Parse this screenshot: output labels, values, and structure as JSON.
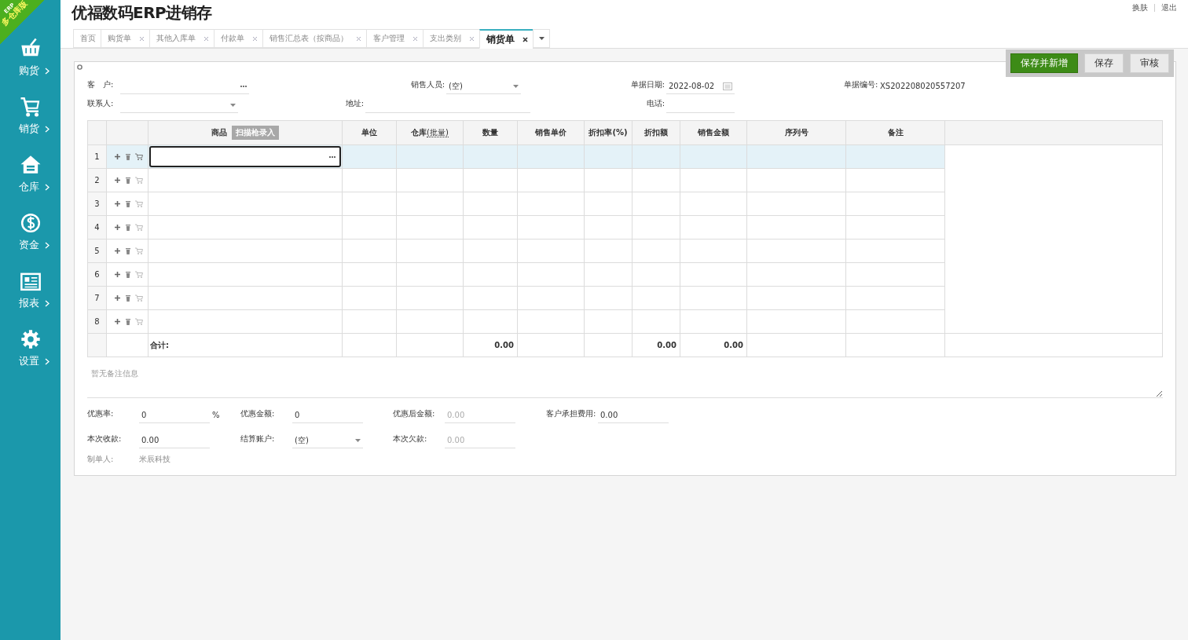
{
  "corner_ribbon": {
    "edition": "ERP",
    "name": "多仓库版"
  },
  "app_title": "优福数码ERP进销存",
  "header_links": [
    "换肤",
    "退出"
  ],
  "sidebar": {
    "items": [
      {
        "label": "购货"
      },
      {
        "label": "销货"
      },
      {
        "label": "仓库"
      },
      {
        "label": "资金"
      },
      {
        "label": "报表"
      },
      {
        "label": "设置"
      }
    ]
  },
  "tabs": [
    {
      "label": "首页",
      "closable": false,
      "selected": false
    },
    {
      "label": "购货单",
      "closable": true,
      "selected": false
    },
    {
      "label": "其他入库单",
      "closable": true,
      "selected": false
    },
    {
      "label": "付款单",
      "closable": true,
      "selected": false
    },
    {
      "label": "销售汇总表（按商品）",
      "closable": true,
      "selected": false
    },
    {
      "label": "客户管理",
      "closable": true,
      "selected": false
    },
    {
      "label": "支出类别",
      "closable": true,
      "selected": false
    },
    {
      "label": "销货单",
      "closable": true,
      "selected": true
    }
  ],
  "toolbar": {
    "buttons": [
      {
        "label": "保存并新增",
        "kind": "primary"
      },
      {
        "label": "保存",
        "kind": "default"
      },
      {
        "label": "审核",
        "kind": "default"
      }
    ]
  },
  "bill_header": {
    "rows": [
      [
        {
          "label": "客　户:",
          "kind": "lookup"
        },
        {
          "label": "销售人员:",
          "kind": "select",
          "value": "(空)"
        },
        {
          "label": "单据日期:",
          "kind": "date",
          "value": "2022-08-02"
        },
        {
          "label": "单据编号:",
          "kind": "static",
          "value": "XS202208020557207"
        }
      ],
      [
        {
          "label": "联系人:",
          "kind": "select"
        },
        {
          "label": "地址:",
          "kind": "text"
        },
        {
          "label": "电话:",
          "kind": "text"
        }
      ]
    ]
  },
  "table": {
    "columns": [
      {
        "label": "商品",
        "button": "扫描枪录入"
      },
      {
        "label": "单位"
      },
      {
        "label": "仓库",
        "link": "(批量)"
      },
      {
        "label": "数量"
      },
      {
        "label": "销售单价"
      },
      {
        "label": "折扣率(%)"
      },
      {
        "label": "折扣额"
      },
      {
        "label": "销售金额"
      },
      {
        "label": "序列号"
      },
      {
        "label": "备注"
      }
    ],
    "rows": [
      {
        "number": "1",
        "selected": true,
        "editing": true
      },
      {
        "number": "2",
        "selected": false,
        "editing": false
      },
      {
        "number": "3",
        "selected": false,
        "editing": false
      },
      {
        "number": "4",
        "selected": false,
        "editing": false
      },
      {
        "number": "5",
        "selected": false,
        "editing": false
      },
      {
        "number": "6",
        "selected": false,
        "editing": false
      },
      {
        "number": "7",
        "selected": false,
        "editing": false
      },
      {
        "number": "8",
        "selected": false,
        "editing": false
      }
    ],
    "totals": {
      "label": "合计:",
      "quantity": "0.00",
      "discount_amount": "0.00",
      "amount": "0.00"
    }
  },
  "remarks": {
    "placeholder": "暂无备注信息"
  },
  "footer": {
    "rows": [
      [
        {
          "label": "优惠率:",
          "kind": "input",
          "value": "0",
          "suffix": "%",
          "disabled": false
        },
        {
          "label": "优惠金额:",
          "kind": "input",
          "value": "0",
          "disabled": false
        },
        {
          "label": "优惠后金额:",
          "kind": "input",
          "value": "0.00",
          "disabled": true
        },
        {
          "label": "客户承担费用:",
          "kind": "input",
          "value": "0.00",
          "disabled": false
        }
      ],
      [
        {
          "label": "本次收款:",
          "kind": "input",
          "value": "0.00",
          "disabled": false
        },
        {
          "label": "结算账户:",
          "kind": "select",
          "value": "(空)",
          "disabled": false
        },
        {
          "label": "本次欠款:",
          "kind": "input",
          "value": "0.00",
          "disabled": true
        }
      ],
      [
        {
          "label": "制单人:",
          "kind": "static",
          "value": "米辰科技"
        }
      ]
    ]
  }
}
